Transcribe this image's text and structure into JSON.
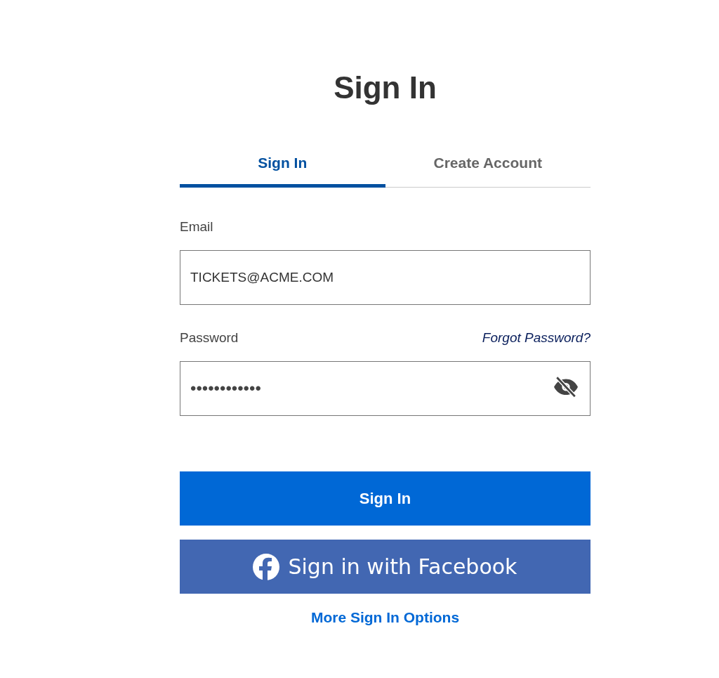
{
  "heading": "Sign In",
  "tabs": [
    {
      "label": "Sign In",
      "selected": true
    },
    {
      "label": "Create Account",
      "selected": false
    }
  ],
  "email": {
    "label": "Email",
    "value": "TICKETS@ACME.COM"
  },
  "password": {
    "label": "Password",
    "forgot_link": "Forgot Password?",
    "value": "••••••••••••",
    "visible": false
  },
  "buttons": [
    {
      "kind": "primary",
      "label": "Sign In"
    },
    {
      "kind": "facebook",
      "label": "Sign in with Facebook"
    }
  ],
  "more_link": "More Sign In Options"
}
